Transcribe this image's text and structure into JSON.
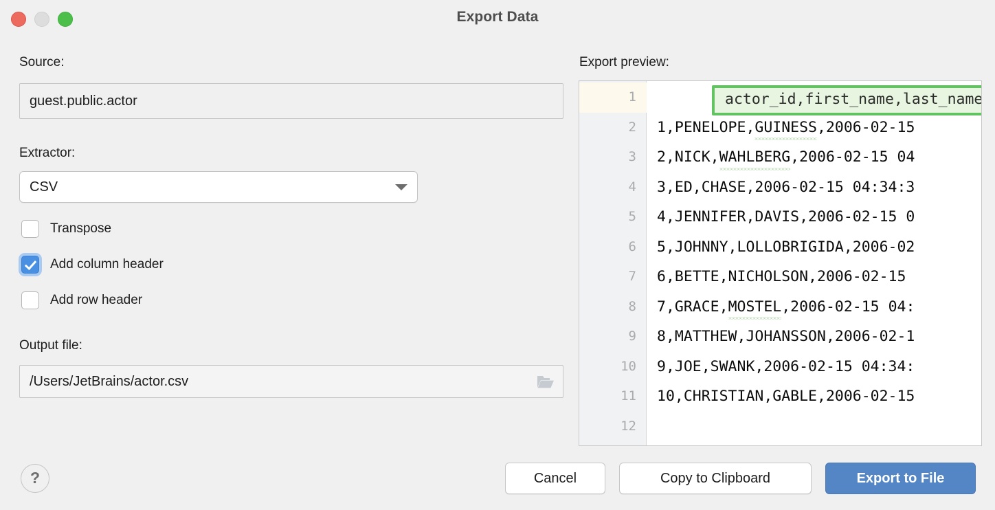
{
  "window": {
    "title": "Export Data",
    "traffic_lights": [
      {
        "name": "close",
        "color": "#ec6a5e"
      },
      {
        "name": "minimize",
        "color": "#dddddd"
      },
      {
        "name": "maximize",
        "color": "#4cbf4a"
      }
    ]
  },
  "form": {
    "source_label": "Source:",
    "source_value": "guest.public.actor",
    "extractor_label": "Extractor:",
    "extractor_value": "CSV",
    "checkboxes": [
      {
        "label": "Transpose",
        "checked": false
      },
      {
        "label": "Add column header",
        "checked": true
      },
      {
        "label": "Add row header",
        "checked": false
      }
    ],
    "output_label": "Output file:",
    "output_value": "/Users/JetBrains/actor.csv",
    "browse_icon": "folder-icon"
  },
  "preview": {
    "label": "Export preview:",
    "highlight_color": "#63c363",
    "highlight_fill": "#e8f5e0",
    "header_line": "actor_id,first_name,last_name",
    "line_numbers": [
      "1",
      "2",
      "3",
      "4",
      "5",
      "6",
      "7",
      "8",
      "9",
      "10",
      "11",
      "12"
    ],
    "lines": [
      {
        "num": "1",
        "text": "actor_id,first_name,last_name",
        "highlighted": true
      },
      {
        "num": "2",
        "text": "1,PENELOPE,GUINESS,2006-02-15",
        "misspelled": "GUINESS"
      },
      {
        "num": "3",
        "text": "2,NICK,WAHLBERG,2006-02-15 04",
        "misspelled": "WAHLBERG"
      },
      {
        "num": "4",
        "text": "3,ED,CHASE,2006-02-15 04:34:3",
        "misspelled": ""
      },
      {
        "num": "5",
        "text": "4,JENNIFER,DAVIS,2006-02-15 0",
        "misspelled": ""
      },
      {
        "num": "6",
        "text": "5,JOHNNY,LOLLOBRIGIDA,2006-02",
        "misspelled": ""
      },
      {
        "num": "7",
        "text": "6,BETTE,NICHOLSON,2006-02-15 ",
        "misspelled": ""
      },
      {
        "num": "8",
        "text": "7,GRACE,MOSTEL,2006-02-15 04:",
        "misspelled": "MOSTEL"
      },
      {
        "num": "9",
        "text": "8,MATTHEW,JOHANSSON,2006-02-1",
        "misspelled": ""
      },
      {
        "num": "10",
        "text": "9,JOE,SWANK,2006-02-15 04:34:",
        "misspelled": ""
      },
      {
        "num": "11",
        "text": "10,CHRISTIAN,GABLE,2006-02-15",
        "misspelled": ""
      },
      {
        "num": "12",
        "text": "",
        "misspelled": ""
      }
    ]
  },
  "footer": {
    "help_label": "?",
    "cancel_label": "Cancel",
    "copy_label": "Copy to Clipboard",
    "export_label": "Export to File",
    "export_color": "#5486c5"
  }
}
